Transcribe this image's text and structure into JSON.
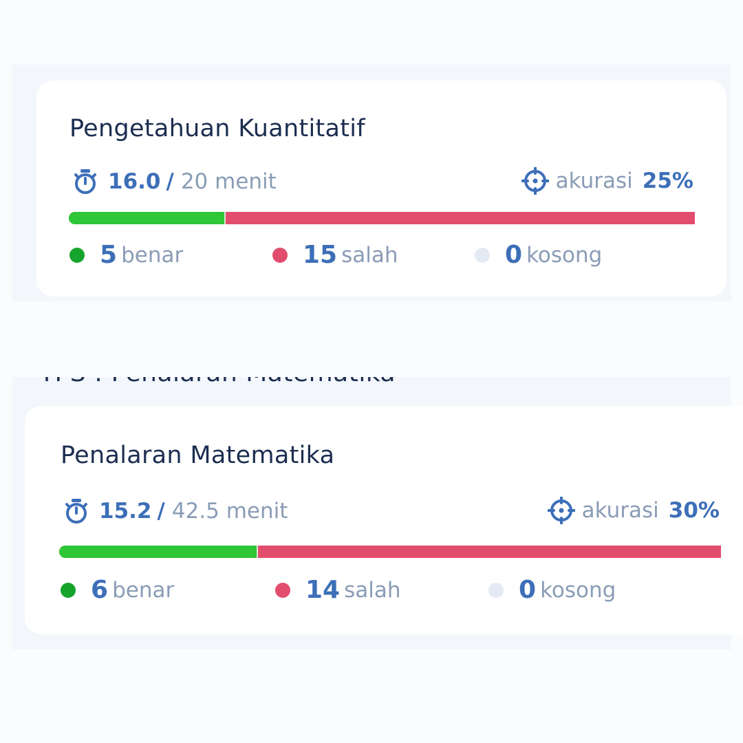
{
  "sections": [
    {
      "title": "Pengetahuan Kuantitatif",
      "time_used": "16.0",
      "time_sep": "/",
      "time_total": "20 menit",
      "accuracy_label": "akurasi",
      "accuracy_value": "25%",
      "progress": {
        "correct_fraction": 0.25,
        "wrong_fraction": 0.75
      },
      "stats": {
        "correct": {
          "count": "5",
          "label": "benar"
        },
        "wrong": {
          "count": "15",
          "label": "salah"
        },
        "empty": {
          "count": "0",
          "label": "kosong"
        }
      }
    },
    {
      "title": "Penalaran Matematika",
      "time_used": "15.2",
      "time_sep": "/",
      "time_total": "42.5 menit",
      "accuracy_label": "akurasi",
      "accuracy_value": "30%",
      "progress": {
        "correct_fraction": 0.3,
        "wrong_fraction": 0.7
      },
      "stats": {
        "correct": {
          "count": "6",
          "label": "benar"
        },
        "wrong": {
          "count": "14",
          "label": "salah"
        },
        "empty": {
          "count": "0",
          "label": "kosong"
        }
      }
    }
  ],
  "partial_header": "TPS : Penalaran Matematika",
  "icons": {
    "timer": "stopwatch-icon",
    "accuracy": "crosshair-icon"
  },
  "colors": {
    "accent": "#3d6fb8",
    "correct": "#2fc637",
    "wrong": "#e24d6e",
    "empty": "#e3eaf4",
    "muted": "#8a9cb5",
    "title": "#1c2d50"
  }
}
